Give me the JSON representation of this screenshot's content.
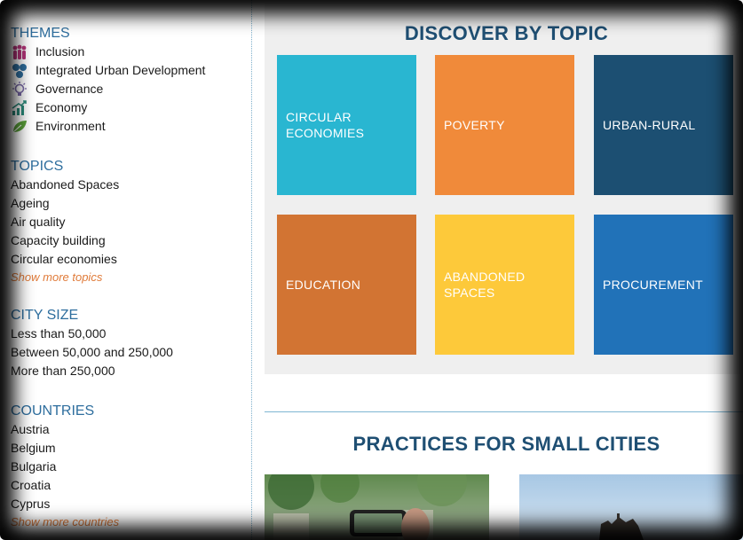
{
  "sidebar": {
    "themes": {
      "title": "THEMES",
      "items": [
        {
          "label": "Inclusion",
          "icon": "people-icon",
          "color": "#b5347a"
        },
        {
          "label": "Integrated Urban Development",
          "icon": "network-icon",
          "color": "#2e6e9e"
        },
        {
          "label": "Governance",
          "icon": "lightbulb-icon",
          "color": "#7a6aa8"
        },
        {
          "label": "Economy",
          "icon": "growth-chart-icon",
          "color": "#2a8a7a"
        },
        {
          "label": "Environment",
          "icon": "leaf-icon",
          "color": "#5aa03a"
        }
      ]
    },
    "topics": {
      "title": "TOPICS",
      "items": [
        "Abandoned Spaces",
        "Ageing",
        "Air quality",
        "Capacity building",
        "Circular economies"
      ],
      "more": "Show more topics"
    },
    "city_size": {
      "title": "CITY SIZE",
      "items": [
        "Less than 50,000",
        "Between 50,000 and 250,000",
        "More than 250,000"
      ]
    },
    "countries": {
      "title": "COUNTRIES",
      "items": [
        "Austria",
        "Belgium",
        "Bulgaria",
        "Croatia",
        "Cyprus"
      ],
      "more": "Show more countries"
    }
  },
  "main": {
    "discover_title": "DISCOVER BY TOPIC",
    "tiles": [
      {
        "label": "CIRCULAR ECONOMIES",
        "color": "#29b6d1"
      },
      {
        "label": "POVERTY",
        "color": "#f08a3a"
      },
      {
        "label": "URBAN-RURAL",
        "color": "#1c4f72"
      },
      {
        "label": "EDUCATION",
        "color": "#d27433"
      },
      {
        "label": "ABANDONED SPACES",
        "color": "#fdc93a"
      },
      {
        "label": "PROCUREMENT",
        "color": "#2172b8"
      }
    ],
    "practices_title": "PRACTICES FOR SMALL CITIES"
  }
}
